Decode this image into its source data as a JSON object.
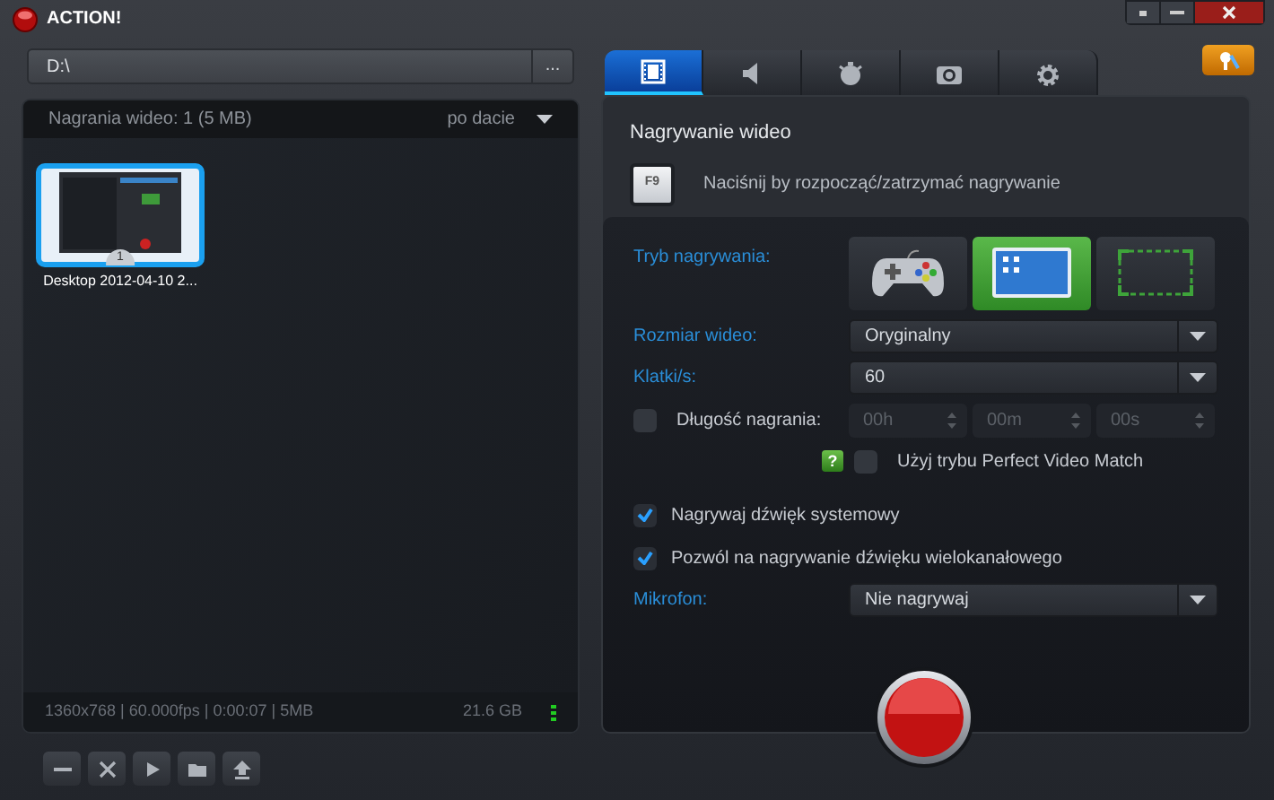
{
  "window": {
    "title": "ACTION!"
  },
  "path_field": {
    "value": "D:\\",
    "browse_label": "..."
  },
  "library": {
    "header": "Nagrania wideo: 1 (5 MB)",
    "sort": "po dacie",
    "items": [
      {
        "caption": "Desktop 2012-04-10 2...",
        "badge": "1",
        "selected": true
      }
    ],
    "status": "1360x768 | 60.000fps | 0:00:07 | 5MB",
    "free_space": "21.6 GB"
  },
  "toolbar": [
    {
      "kind": "remove"
    },
    {
      "kind": "delete"
    },
    {
      "kind": "play"
    },
    {
      "kind": "folder"
    },
    {
      "kind": "upload"
    }
  ],
  "tabs": [
    {
      "kind": "video",
      "selected": true
    },
    {
      "kind": "audio",
      "selected": false
    },
    {
      "kind": "timer",
      "selected": false
    },
    {
      "kind": "camera",
      "selected": false
    },
    {
      "kind": "settings",
      "selected": false
    }
  ],
  "section": {
    "title": "Nagrywanie wideo",
    "hotkey": "F9",
    "hotkey_hint": "Naciśnij by rozpocząć/zatrzymać nagrywanie"
  },
  "modes": {
    "label": "Tryb nagrywania:",
    "options": [
      {
        "kind": "game",
        "selected": false
      },
      {
        "kind": "desktop",
        "selected": true
      },
      {
        "kind": "region",
        "selected": false
      }
    ]
  },
  "video_size": {
    "label": "Rozmiar wideo:",
    "value": "Oryginalny"
  },
  "fps": {
    "label": "Klatki/s:",
    "value": "60"
  },
  "duration": {
    "label": "Długość nagrania:",
    "checked": false,
    "fields": [
      "00h",
      "00m",
      "00s"
    ]
  },
  "perfect_video_match": {
    "help": "?",
    "label": "Użyj trybu Perfect Video Match",
    "checked": false
  },
  "options": [
    {
      "label": "Nagrywaj dźwięk systemowy",
      "checked": true
    },
    {
      "label": "Pozwól na nagrywanie dźwięku wielokanałowego",
      "checked": true
    }
  ],
  "microphone": {
    "label": "Mikrofon:",
    "value": "Nie nagrywaj"
  }
}
